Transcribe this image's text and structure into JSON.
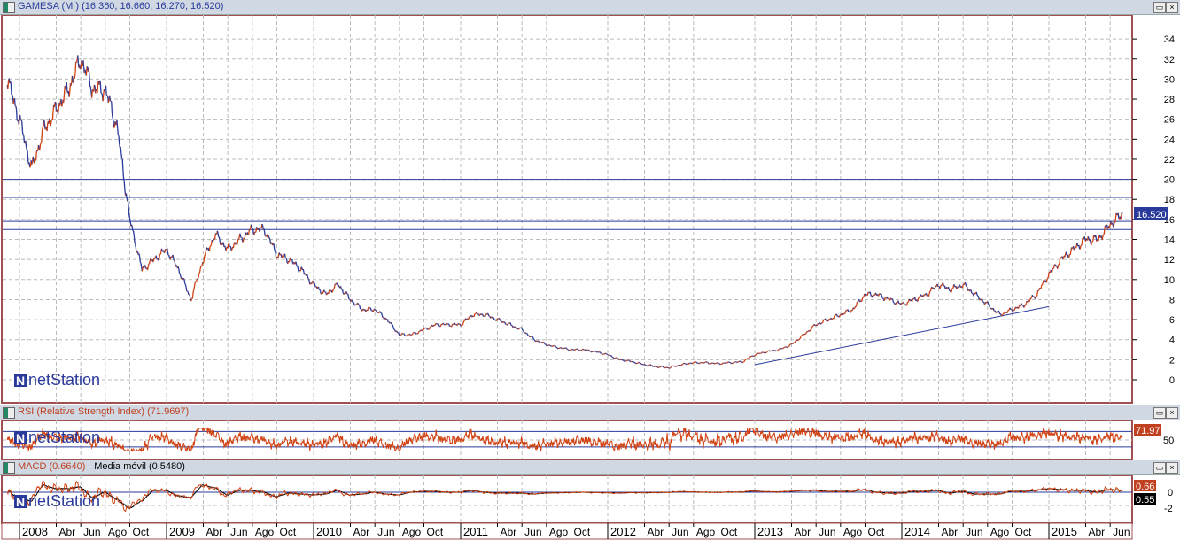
{
  "main_header": {
    "title": "GAMESA (M ) (16.360, 16.660, 16.270, 16.520)"
  },
  "rsi_header": {
    "title": "RSI (Relative Strength Index) (71.9697)",
    "last": "71.97",
    "tick": "50"
  },
  "macd_header": {
    "title": "MACD (0.6640)",
    "sep": " - ",
    "ma": "Media móvil (0.5480)",
    "last": "0.66",
    "ma_last": "0.55",
    "ticks": [
      "0",
      "-2"
    ]
  },
  "watermark": "netStation",
  "buttons": {
    "maximize": "▭",
    "close": "×"
  },
  "colors": {
    "up": "#d04010",
    "down": "#2a3a9a",
    "level": "#2a3a9a",
    "grid": "#bbbbbb",
    "frame": "#a05050"
  },
  "chart_data": {
    "type": "line",
    "title": "GAMESA (M )",
    "ylim": [
      -2,
      36
    ],
    "yticks": [
      0,
      2,
      4,
      6,
      8,
      10,
      12,
      14,
      16,
      18,
      20,
      22,
      24,
      26,
      28,
      30,
      32,
      34
    ],
    "last_value": "16.520",
    "horizontal_levels": [
      20,
      18.2,
      15.8,
      15.0
    ],
    "trendline": [
      [
        "2013-01",
        1.5
      ],
      [
        "2015-01",
        7.3
      ]
    ],
    "xticks": [
      {
        "d": "2008-01",
        "l": "2008"
      },
      {
        "d": "2008-04",
        "l": "Abr"
      },
      {
        "d": "2008-06",
        "l": "Jun"
      },
      {
        "d": "2008-08",
        "l": "Ago"
      },
      {
        "d": "2008-10",
        "l": "Oct"
      },
      {
        "d": "2009-01",
        "l": "2009"
      },
      {
        "d": "2009-04",
        "l": "Abr"
      },
      {
        "d": "2009-06",
        "l": "Jun"
      },
      {
        "d": "2009-08",
        "l": "Ago"
      },
      {
        "d": "2009-10",
        "l": "Oct"
      },
      {
        "d": "2010-01",
        "l": "2010"
      },
      {
        "d": "2010-04",
        "l": "Abr"
      },
      {
        "d": "2010-06",
        "l": "Jun"
      },
      {
        "d": "2010-08",
        "l": "Ago"
      },
      {
        "d": "2010-10",
        "l": "Oct"
      },
      {
        "d": "2011-01",
        "l": "2011"
      },
      {
        "d": "2011-04",
        "l": "Abr"
      },
      {
        "d": "2011-06",
        "l": "Jun"
      },
      {
        "d": "2011-08",
        "l": "Ago"
      },
      {
        "d": "2011-10",
        "l": "Oct"
      },
      {
        "d": "2012-01",
        "l": "2012"
      },
      {
        "d": "2012-04",
        "l": "Abr"
      },
      {
        "d": "2012-06",
        "l": "Jun"
      },
      {
        "d": "2012-08",
        "l": "Ago"
      },
      {
        "d": "2012-10",
        "l": "Oct"
      },
      {
        "d": "2013-01",
        "l": "2013"
      },
      {
        "d": "2013-04",
        "l": "Abr"
      },
      {
        "d": "2013-06",
        "l": "Jun"
      },
      {
        "d": "2013-08",
        "l": "Ago"
      },
      {
        "d": "2013-10",
        "l": "Oct"
      },
      {
        "d": "2014-01",
        "l": "2014"
      },
      {
        "d": "2014-04",
        "l": "Abr"
      },
      {
        "d": "2014-06",
        "l": "Jun"
      },
      {
        "d": "2014-08",
        "l": "Ago"
      },
      {
        "d": "2014-10",
        "l": "Oct"
      },
      {
        "d": "2015-01",
        "l": "2015"
      },
      {
        "d": "2015-04",
        "l": "Abr"
      },
      {
        "d": "2015-06",
        "l": "Jun"
      }
    ],
    "series": [
      {
        "values": [
          [
            "2007-12",
            30
          ],
          [
            "2008-01",
            26
          ],
          [
            "2008-02",
            21
          ],
          [
            "2008-03",
            25
          ],
          [
            "2008-04",
            27
          ],
          [
            "2008-05",
            29
          ],
          [
            "2008-06",
            32
          ],
          [
            "2008-07",
            29
          ],
          [
            "2008-08",
            29
          ],
          [
            "2008-09",
            25
          ],
          [
            "2008-10",
            16
          ],
          [
            "2008-11",
            11
          ],
          [
            "2008-12",
            12
          ],
          [
            "2009-01",
            13
          ],
          [
            "2009-02",
            11
          ],
          [
            "2009-03",
            8
          ],
          [
            "2009-04",
            12
          ],
          [
            "2009-05",
            14.5
          ],
          [
            "2009-06",
            13
          ],
          [
            "2009-07",
            14
          ],
          [
            "2009-08",
            15
          ],
          [
            "2009-09",
            15
          ],
          [
            "2009-10",
            12.5
          ],
          [
            "2009-11",
            12
          ],
          [
            "2009-12",
            11
          ],
          [
            "2010-01",
            9.5
          ],
          [
            "2010-02",
            8.5
          ],
          [
            "2010-03",
            9.5
          ],
          [
            "2010-04",
            8
          ],
          [
            "2010-05",
            7
          ],
          [
            "2010-06",
            7
          ],
          [
            "2010-07",
            6
          ],
          [
            "2010-08",
            4.5
          ],
          [
            "2010-09",
            4.5
          ],
          [
            "2010-10",
            5
          ],
          [
            "2010-11",
            5.5
          ],
          [
            "2010-12",
            5.5
          ],
          [
            "2011-01",
            5.5
          ],
          [
            "2011-02",
            6.5
          ],
          [
            "2011-03",
            6.5
          ],
          [
            "2011-04",
            6
          ],
          [
            "2011-05",
            5.5
          ],
          [
            "2011-06",
            5
          ],
          [
            "2011-07",
            4
          ],
          [
            "2011-08",
            3.5
          ],
          [
            "2011-09",
            3.2
          ],
          [
            "2011-10",
            3
          ],
          [
            "2011-11",
            3
          ],
          [
            "2011-12",
            2.8
          ],
          [
            "2012-01",
            2.5
          ],
          [
            "2012-02",
            2
          ],
          [
            "2012-03",
            1.8
          ],
          [
            "2012-04",
            1.5
          ],
          [
            "2012-05",
            1.3
          ],
          [
            "2012-06",
            1.2
          ],
          [
            "2012-07",
            1.5
          ],
          [
            "2012-08",
            1.7
          ],
          [
            "2012-09",
            1.7
          ],
          [
            "2012-10",
            1.6
          ],
          [
            "2012-11",
            1.7
          ],
          [
            "2012-12",
            1.8
          ],
          [
            "2013-01",
            2.5
          ],
          [
            "2013-02",
            2.8
          ],
          [
            "2013-03",
            3
          ],
          [
            "2013-04",
            3.5
          ],
          [
            "2013-05",
            4.5
          ],
          [
            "2013-06",
            5.5
          ],
          [
            "2013-07",
            6
          ],
          [
            "2013-08",
            6.5
          ],
          [
            "2013-09",
            7
          ],
          [
            "2013-10",
            8.5
          ],
          [
            "2013-11",
            8.5
          ],
          [
            "2013-12",
            8
          ],
          [
            "2014-01",
            7.5
          ],
          [
            "2014-02",
            8
          ],
          [
            "2014-03",
            8.5
          ],
          [
            "2014-04",
            9.5
          ],
          [
            "2014-05",
            9
          ],
          [
            "2014-06",
            9.5
          ],
          [
            "2014-07",
            8.5
          ],
          [
            "2014-08",
            7.5
          ],
          [
            "2014-09",
            6.5
          ],
          [
            "2014-10",
            7
          ],
          [
            "2014-11",
            7.5
          ],
          [
            "2014-12",
            8.5
          ],
          [
            "2015-01",
            10.5
          ],
          [
            "2015-02",
            12
          ],
          [
            "2015-03",
            13
          ],
          [
            "2015-04",
            14
          ],
          [
            "2015-05",
            14
          ],
          [
            "2015-06",
            15.5
          ],
          [
            "2015-07",
            16.52
          ]
        ]
      }
    ]
  }
}
